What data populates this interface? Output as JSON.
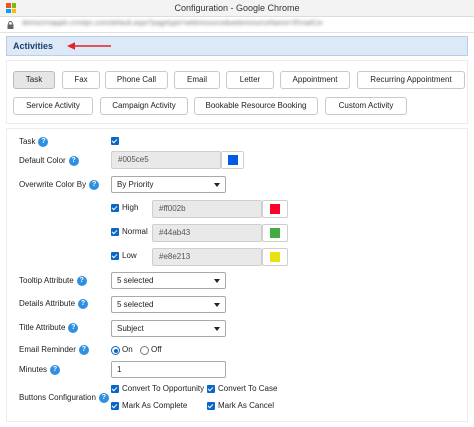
{
  "window": {
    "title": "Configuration - Google Chrome",
    "url": "democrmappln.crmdyn.com/default.aspx?pagetype=webresource&webresourceName=/EmailConfiguration"
  },
  "section": {
    "title": "Activities"
  },
  "tabs": [
    {
      "label": "Task",
      "active": true
    },
    {
      "label": "Fax"
    },
    {
      "label": "Phone Call"
    },
    {
      "label": "Email"
    },
    {
      "label": "Letter"
    },
    {
      "label": "Appointment"
    },
    {
      "label": "Recurring Appointment"
    },
    {
      "label": "Service Activity"
    },
    {
      "label": "Campaign Activity"
    },
    {
      "label": "Bookable Resource Booking"
    },
    {
      "label": "Custom Activity"
    }
  ],
  "form": {
    "task": {
      "label": "Task",
      "checked": true
    },
    "default_color": {
      "label": "Default Color",
      "value": "#005ce5",
      "swatch": "#005ce5"
    },
    "overwrite_color_by": {
      "label": "Overwrite Color By",
      "value": "By Priority"
    },
    "priorities": [
      {
        "label": "High",
        "checked": true,
        "value": "#ff002b",
        "swatch": "#ff002b"
      },
      {
        "label": "Normal",
        "checked": true,
        "value": "#44ab43",
        "swatch": "#44ab43"
      },
      {
        "label": "Low",
        "checked": true,
        "value": "#e8e213",
        "swatch": "#e8e213"
      }
    ],
    "tooltip_attribute": {
      "label": "Tooltip Attribute",
      "value": "5 selected"
    },
    "details_attribute": {
      "label": "Details Attribute",
      "value": "5 selected"
    },
    "title_attribute": {
      "label": "Title Attribute",
      "value": "Subject"
    },
    "email_reminder": {
      "label": "Email Reminder",
      "on_label": "On",
      "off_label": "Off",
      "selected": "On"
    },
    "minutes": {
      "label": "Minutes",
      "value": "1"
    },
    "buttons_configuration": {
      "label": "Buttons Configuration",
      "options": [
        {
          "label": "Convert To Opportunity",
          "checked": true
        },
        {
          "label": "Convert To Case",
          "checked": true
        },
        {
          "label": "Mark As Complete",
          "checked": true
        },
        {
          "label": "Mark As Cancel",
          "checked": true
        }
      ]
    }
  },
  "icons": {
    "help": "question-circle-icon",
    "checkbox": "checkmark-icon",
    "arrow": "red-arrow-icon"
  },
  "colors": {
    "accent": "#0a67c7",
    "help": "#2f8fe0",
    "header_bg": "#dde9f6",
    "arrow": "#e0242b"
  }
}
